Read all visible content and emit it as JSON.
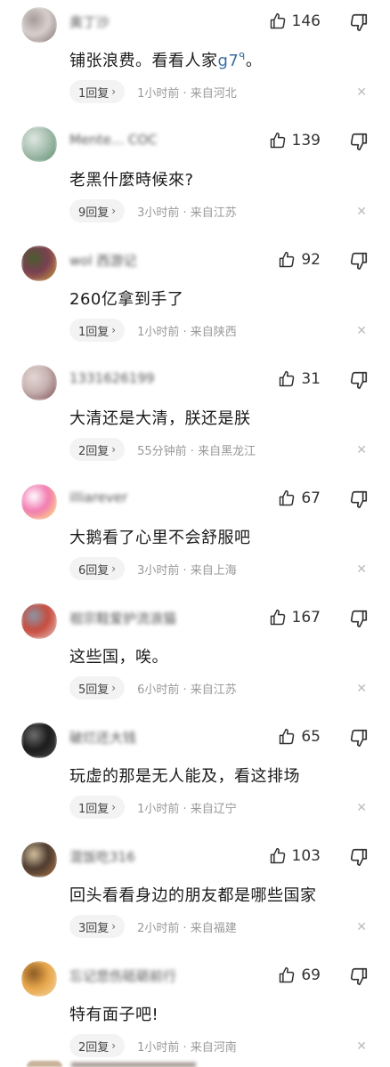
{
  "comments": [
    {
      "username": "奥丁沙",
      "likes": "146",
      "text": "铺张浪费。看看人家",
      "highlight": "g7",
      "suffix": "。",
      "reply": "1回复",
      "time": "1小时前",
      "location": "来自河北",
      "avatar_colors": [
        "#d8d0cf",
        "#7e6c6a",
        "#a69a98"
      ]
    },
    {
      "username": "Mente... COC",
      "likes": "139",
      "text": "老黑什麼時候來?",
      "reply": "9回复",
      "time": "3小时前",
      "location": "来自江苏",
      "avatar_colors": [
        "#a8c0b0",
        "#5a8b6b",
        "#dfe7e1"
      ]
    },
    {
      "username": "wol 西游记",
      "likes": "92",
      "text": "260亿拿到手了",
      "reply": "1回复",
      "time": "1小时前",
      "location": "来自陕西",
      "avatar_colors": [
        "#7a3f52",
        "#d4a23a",
        "#4a5c2e"
      ]
    },
    {
      "username": "1331626199",
      "likes": "31",
      "text": "大清还是大清，朕还是朕",
      "reply": "2回复",
      "time": "55分钟前",
      "location": "来自黑龙江",
      "avatar_colors": [
        "#c7b2b0",
        "#7a4a4f",
        "#e3d7d5"
      ]
    },
    {
      "username": "illiarever",
      "likes": "67",
      "text": "大鹅看了心里不会舒服吧",
      "reply": "6回复",
      "time": "3小时前",
      "location": "来自上海",
      "avatar_colors": [
        "#f27ab2",
        "#fff176",
        "#ffffff"
      ]
    },
    {
      "username": "祖宗鞋爱护流浪猫",
      "likes": "167",
      "text": "这些国，唉。",
      "reply": "5回复",
      "time": "6小时前",
      "location": "来自江苏",
      "avatar_colors": [
        "#c74a3c",
        "#e8c9c4",
        "#8a98a8"
      ]
    },
    {
      "username": "破烂还大钱",
      "likes": "65",
      "text": "玩虚的那是无人能及，看这排场",
      "reply": "1回复",
      "time": "1小时前",
      "location": "来自辽宁",
      "avatar_colors": [
        "#1b1b1b",
        "#4b4b4b",
        "#6f6f6f"
      ]
    },
    {
      "username": "混饭吃316",
      "likes": "103",
      "text": "回头看看身边的朋友都是哪些国家",
      "reply": "3回复",
      "time": "2小时前",
      "location": "来自福建",
      "avatar_colors": [
        "#4b3a2e",
        "#b77b4e",
        "#d6c2a0"
      ]
    },
    {
      "username": "忘记悲伤砥砺前行",
      "likes": "69",
      "text": "特有面子吧!",
      "reply": "2回复",
      "time": "1小时前",
      "location": "来自河南",
      "avatar_colors": [
        "#e7a64a",
        "#f5d9a4",
        "#8a5a24"
      ]
    }
  ],
  "icons": {
    "like": "thumb-up-icon",
    "dislike": "thumb-down-icon",
    "close": "close-icon",
    "reply_chevron": "chevron-right-icon"
  },
  "symbols": {
    "chevron": "›",
    "close": "✕",
    "dot": "·"
  }
}
